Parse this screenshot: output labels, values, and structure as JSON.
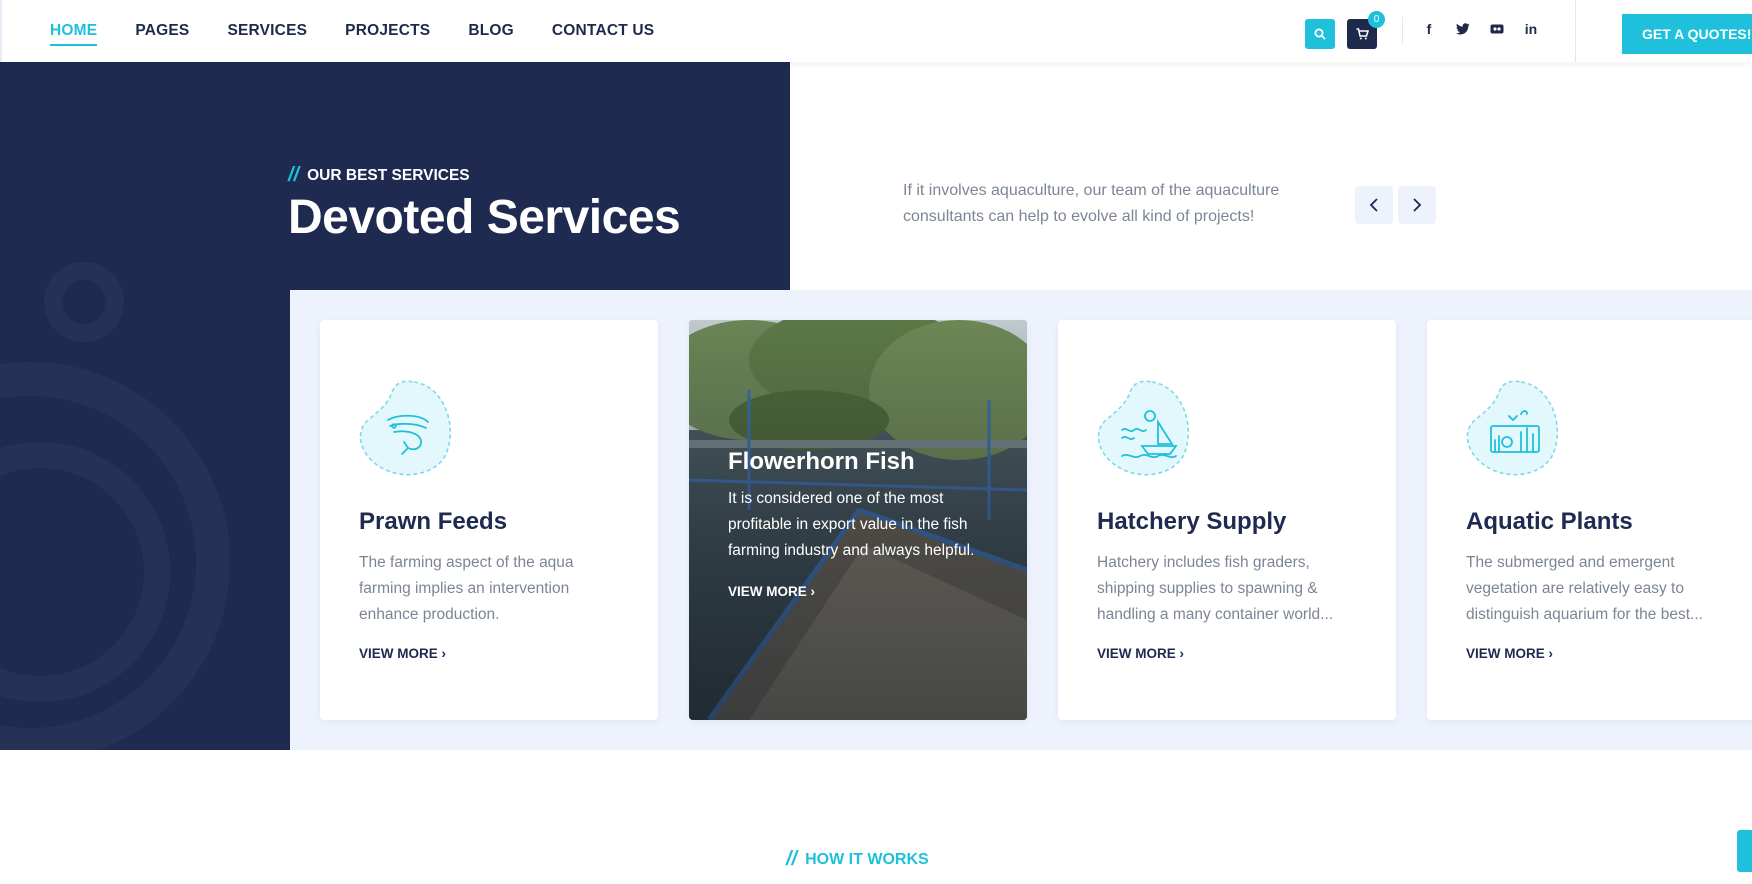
{
  "nav": {
    "items": [
      {
        "label": "HOME",
        "active": true
      },
      {
        "label": "PAGES",
        "active": false
      },
      {
        "label": "SERVICES",
        "active": false
      },
      {
        "label": "PROJECTS",
        "active": false
      },
      {
        "label": "BLOG",
        "active": false
      },
      {
        "label": "CONTACT US",
        "active": false
      }
    ],
    "cart_count": "0",
    "social": [
      "facebook-icon",
      "twitter-icon",
      "flickr-icon",
      "linkedin-icon"
    ],
    "quote_label": "GET A QUOTES!"
  },
  "section": {
    "eyebrow": "OUR BEST SERVICES",
    "heading": "Devoted Services",
    "intro": "If it involves aquaculture, our team of the aquaculture consultants can help to evolve all kind of projects!"
  },
  "cards": [
    {
      "title": "Prawn Feeds",
      "desc": "The farming aspect of the aqua farming implies an intervention enhance production.",
      "more": "VIEW MORE",
      "icon": "prawn-icon"
    },
    {
      "title": "Flowerhorn Fish",
      "desc": "It is considered one of the most profitable in export value in the fish farming industry and always helpful.",
      "more": "VIEW MORE",
      "icon": "fish-pond-photo"
    },
    {
      "title": "Hatchery Supply",
      "desc": "Hatchery includes fish graders, shipping supplies to spawning & handling a many container world...",
      "more": "VIEW MORE",
      "icon": "boat-icon"
    },
    {
      "title": "Aquatic Plants",
      "desc": "The submerged and emergent vegetation are relatively easy to distinguish aquarium for the best...",
      "more": "VIEW MORE",
      "icon": "aquarium-icon"
    }
  ],
  "how": {
    "label": "HOW IT WORKS"
  },
  "colors": {
    "accent": "#1ec0dc",
    "navy": "#1e2a4f",
    "light_bg": "#eef2fd"
  }
}
